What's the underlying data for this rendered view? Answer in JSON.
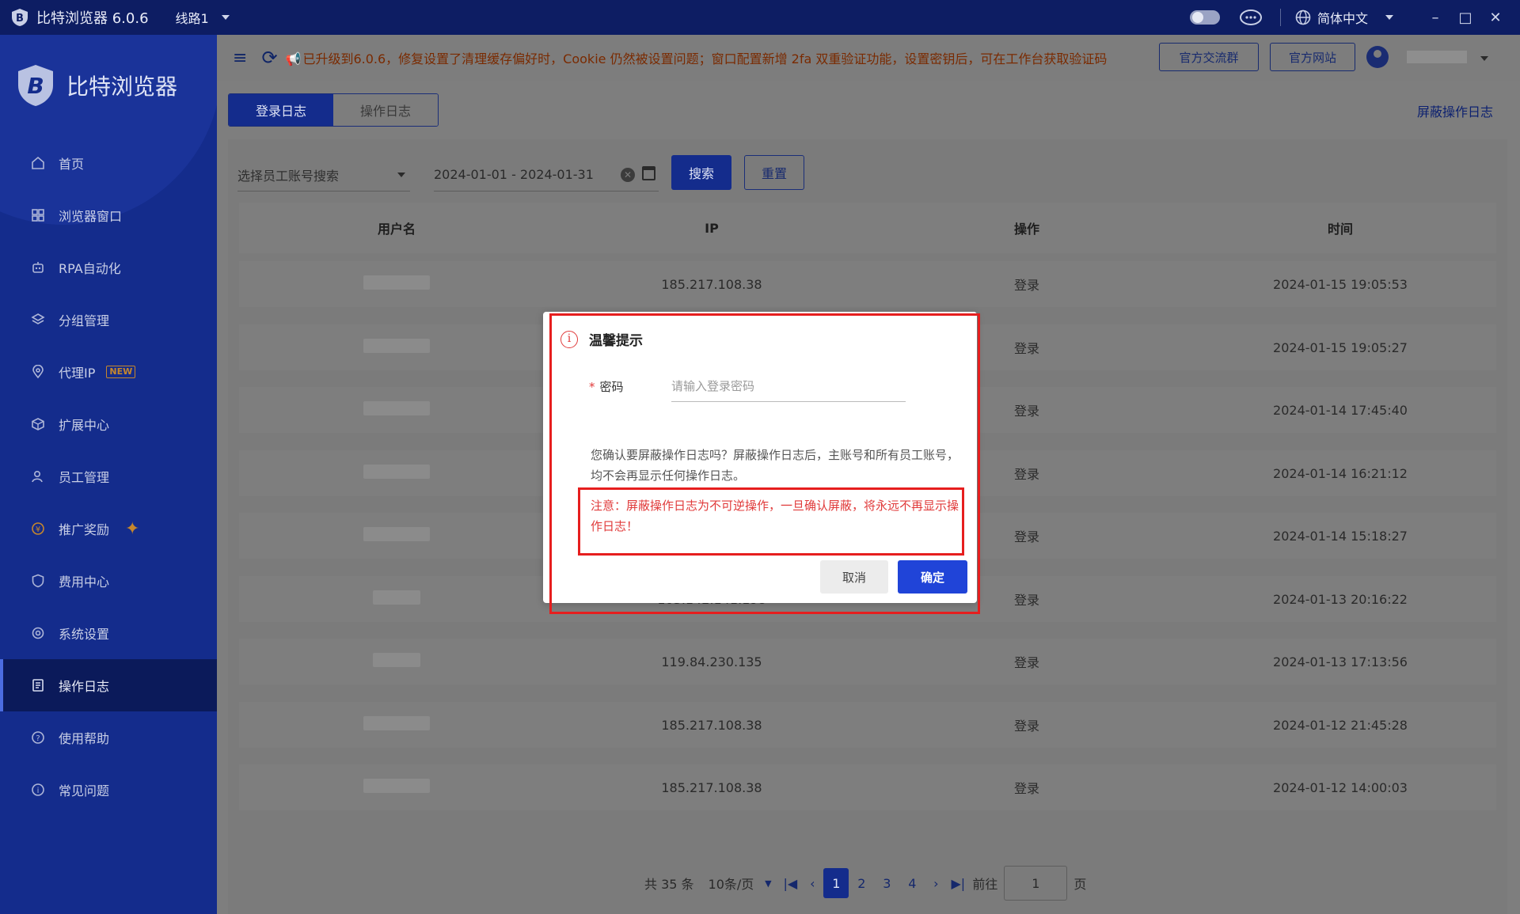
{
  "titlebar": {
    "app_name": "比特浏览器 6.0.6",
    "line": "线路1",
    "language": "简体中文"
  },
  "sidebar": {
    "brand": "比特浏览器",
    "items": [
      {
        "label": "首页",
        "icon": "home-icon"
      },
      {
        "label": "浏览器窗口",
        "icon": "grid-icon"
      },
      {
        "label": "RPA自动化",
        "icon": "robot-icon"
      },
      {
        "label": "分组管理",
        "icon": "layers-icon"
      },
      {
        "label": "代理IP",
        "icon": "location-icon",
        "badge": "NEW"
      },
      {
        "label": "扩展中心",
        "icon": "cube-icon"
      },
      {
        "label": "员工管理",
        "icon": "users-icon"
      },
      {
        "label": "推广奖励",
        "icon": "coin-icon"
      },
      {
        "label": "费用中心",
        "icon": "shield-yen-icon"
      },
      {
        "label": "系统设置",
        "icon": "settings-icon"
      },
      {
        "label": "操作日志",
        "icon": "log-icon",
        "active": true
      },
      {
        "label": "使用帮助",
        "icon": "help-icon"
      },
      {
        "label": "常见问题",
        "icon": "info-icon"
      }
    ]
  },
  "topbar": {
    "notice": "已升级到6.0.6，修复设置了清理缓存偏好时，Cookie 仍然被设置问题；窗口配置新增 2fa 双重验证功能，设置密钥后，可在工作台获取验证码",
    "group_button": "官方交流群",
    "site_button": "官方网站"
  },
  "tabs": {
    "login_log": "登录日志",
    "operation_log": "操作日志"
  },
  "hide_log_link": "屏蔽操作日志",
  "filter": {
    "employee_placeholder": "选择员工账号搜索",
    "date_range": "2024-01-01 - 2024-01-31",
    "search_button": "搜索",
    "reset_button": "重置"
  },
  "table": {
    "headers": [
      "用户名",
      "IP",
      "操作",
      "时间"
    ],
    "rows": [
      {
        "ip": "185.217.108.38",
        "action": "登录",
        "time": "2024-01-15 19:05:53"
      },
      {
        "ip": "",
        "action": "登录",
        "time": "2024-01-15 19:05:27"
      },
      {
        "ip": "",
        "action": "登录",
        "time": "2024-01-14 17:45:40"
      },
      {
        "ip": "",
        "action": "登录",
        "time": "2024-01-14 16:21:12"
      },
      {
        "ip": "",
        "action": "登录",
        "time": "2024-01-14 15:18:27"
      },
      {
        "ip": "103.142.141.198",
        "action": "登录",
        "time": "2024-01-13 20:16:22"
      },
      {
        "ip": "119.84.230.135",
        "action": "登录",
        "time": "2024-01-13 17:13:56"
      },
      {
        "ip": "185.217.108.38",
        "action": "登录",
        "time": "2024-01-12 21:45:28"
      },
      {
        "ip": "185.217.108.38",
        "action": "登录",
        "time": "2024-01-12 14:00:03"
      }
    ]
  },
  "pager": {
    "total": "共 35 条",
    "page_size": "10条/页",
    "pages": [
      "1",
      "2",
      "3",
      "4"
    ],
    "goto_label": "前往",
    "goto_value": "1",
    "page_suffix": "页"
  },
  "modal": {
    "title": "温馨提示",
    "password_label": "密码",
    "password_placeholder": "请输入登录密码",
    "message": "您确认要屏蔽操作日志吗？屏蔽操作日志后，主账号和所有员工账号，均不会再显示任何操作日志。",
    "warning": "注意：屏蔽操作日志为不可逆操作，一旦确认屏蔽，将永远不再显示操作日志！",
    "cancel": "取消",
    "confirm": "确定"
  },
  "colors": {
    "sidebar": "#142c8c",
    "titlebar": "#0d1d63",
    "primary_button": "#2044d8",
    "warning_red": "#e03a3a",
    "highlight_frame": "#e61e1e"
  }
}
